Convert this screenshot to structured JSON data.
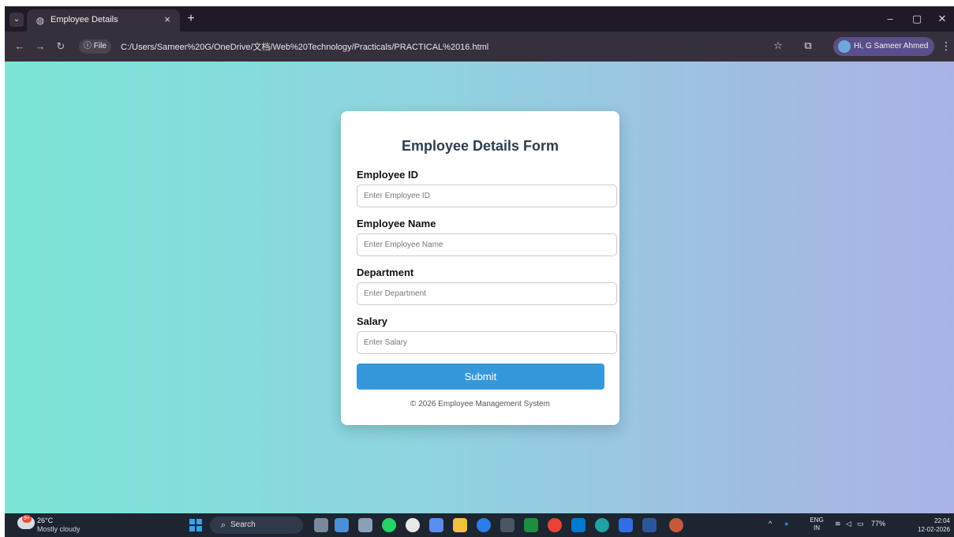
{
  "browser": {
    "tab_title": "Employee Details",
    "tab_close": "×",
    "new_tab": "+",
    "site_chip": "ⓘ File",
    "url": "C:/Users/Sameer%20G/OneDrive/文档/Web%20Technology/Practicals/PRACTICAL%2016.html",
    "profile_label": "Hi, G Sameer Ahmed"
  },
  "form": {
    "title": "Employee Details Form",
    "fields": [
      {
        "label": "Employee ID",
        "placeholder": "Enter Employee ID"
      },
      {
        "label": "Employee Name",
        "placeholder": "Enter Employee Name"
      },
      {
        "label": "Department",
        "placeholder": "Enter Department"
      },
      {
        "label": "Salary",
        "placeholder": "Enter Salary"
      }
    ],
    "submit_label": "Submit",
    "footer": "© 2026 Employee Management System"
  },
  "taskbar": {
    "temperature": "26°C",
    "weather": "Mostly cloudy",
    "weather_badge": "9+",
    "search_label": "Search",
    "lang_top": "ENG",
    "lang_bottom": "IN",
    "battery": "77%",
    "time": "22:04",
    "date": "12-02-2026",
    "pinned_icons": [
      "explorer-icon",
      "whatsapp-icon",
      "chatgpt-icon",
      "folder-icon",
      "bluetooth-icon",
      "terminal-icon",
      "chrome-icon",
      "vscode-icon",
      "edge-icon",
      "word-icon"
    ]
  },
  "colors": {
    "accent": "#3498db",
    "title": "#2c3e50",
    "gradient_start": "#7be6d6",
    "gradient_end": "#aab3e6"
  }
}
